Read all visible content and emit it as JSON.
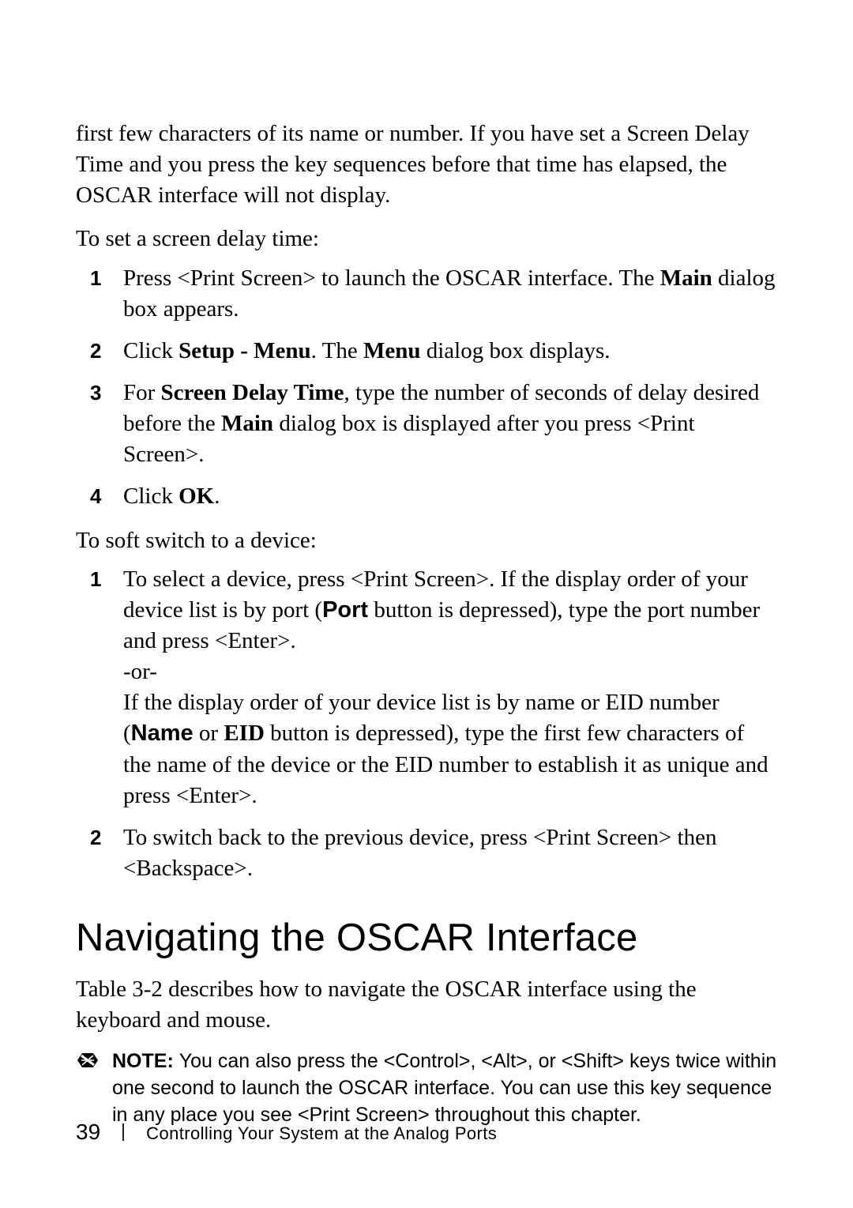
{
  "intro": {
    "p1_a": "first few characters of its name or number. If you have set a Screen Delay Time and you press the key sequences before that time has elapsed, the OSCAR interface will not display.",
    "p2": "To set a screen delay time:"
  },
  "list1": {
    "n1": "1",
    "i1_a": "Press <Print Screen> to launch the OSCAR interface. The ",
    "i1_b": "Main",
    "i1_c": " dialog box appears.",
    "n2": "2",
    "i2_a": "Click ",
    "i2_b": "Setup - Menu",
    "i2_c": ". The ",
    "i2_d": "Menu",
    "i2_e": " dialog box displays.",
    "n3": "3",
    "i3_a": "For ",
    "i3_b": "Screen Delay Time",
    "i3_c": ", type the number of seconds of delay desired before the ",
    "i3_d": "Main",
    "i3_e": " dialog box is displayed after you press <Print Screen>.",
    "n4": "4",
    "i4_a": "Click ",
    "i4_b": "OK",
    "i4_c": "."
  },
  "mid": {
    "p": "To soft switch to a device:"
  },
  "list2": {
    "n1": "1",
    "i1_a": "To select a device, press <Print Screen>. If the display order of your device list is by port (",
    "i1_b": "Port",
    "i1_c": " button is depressed), type the port number and press <Enter>.",
    "i1_d": "-or-",
    "i1_e": "If the display order of your device list is by name or EID number (",
    "i1_f": "Name",
    "i1_g": " or ",
    "i1_h": "EID",
    "i1_i": " button is depressed), type the first few characters of the name of the device or the EID number to establish it as unique and press <Enter>.",
    "n2": "2",
    "i2_a": "To switch back to the previous device, press <Print Screen> then <Backspace>."
  },
  "section": {
    "heading": "Navigating the OSCAR Interface",
    "p": "Table 3-2 describes how to navigate the OSCAR interface using the keyboard and mouse."
  },
  "note": {
    "label": "NOTE: ",
    "text": "You can also press the <Control>, <Alt>, or <Shift> keys twice within one second to launch the OSCAR interface. You can use this key sequence in any place you see <Print Screen> throughout this chapter."
  },
  "footer": {
    "page": "39",
    "title": "Controlling Your System at the Analog Ports"
  }
}
